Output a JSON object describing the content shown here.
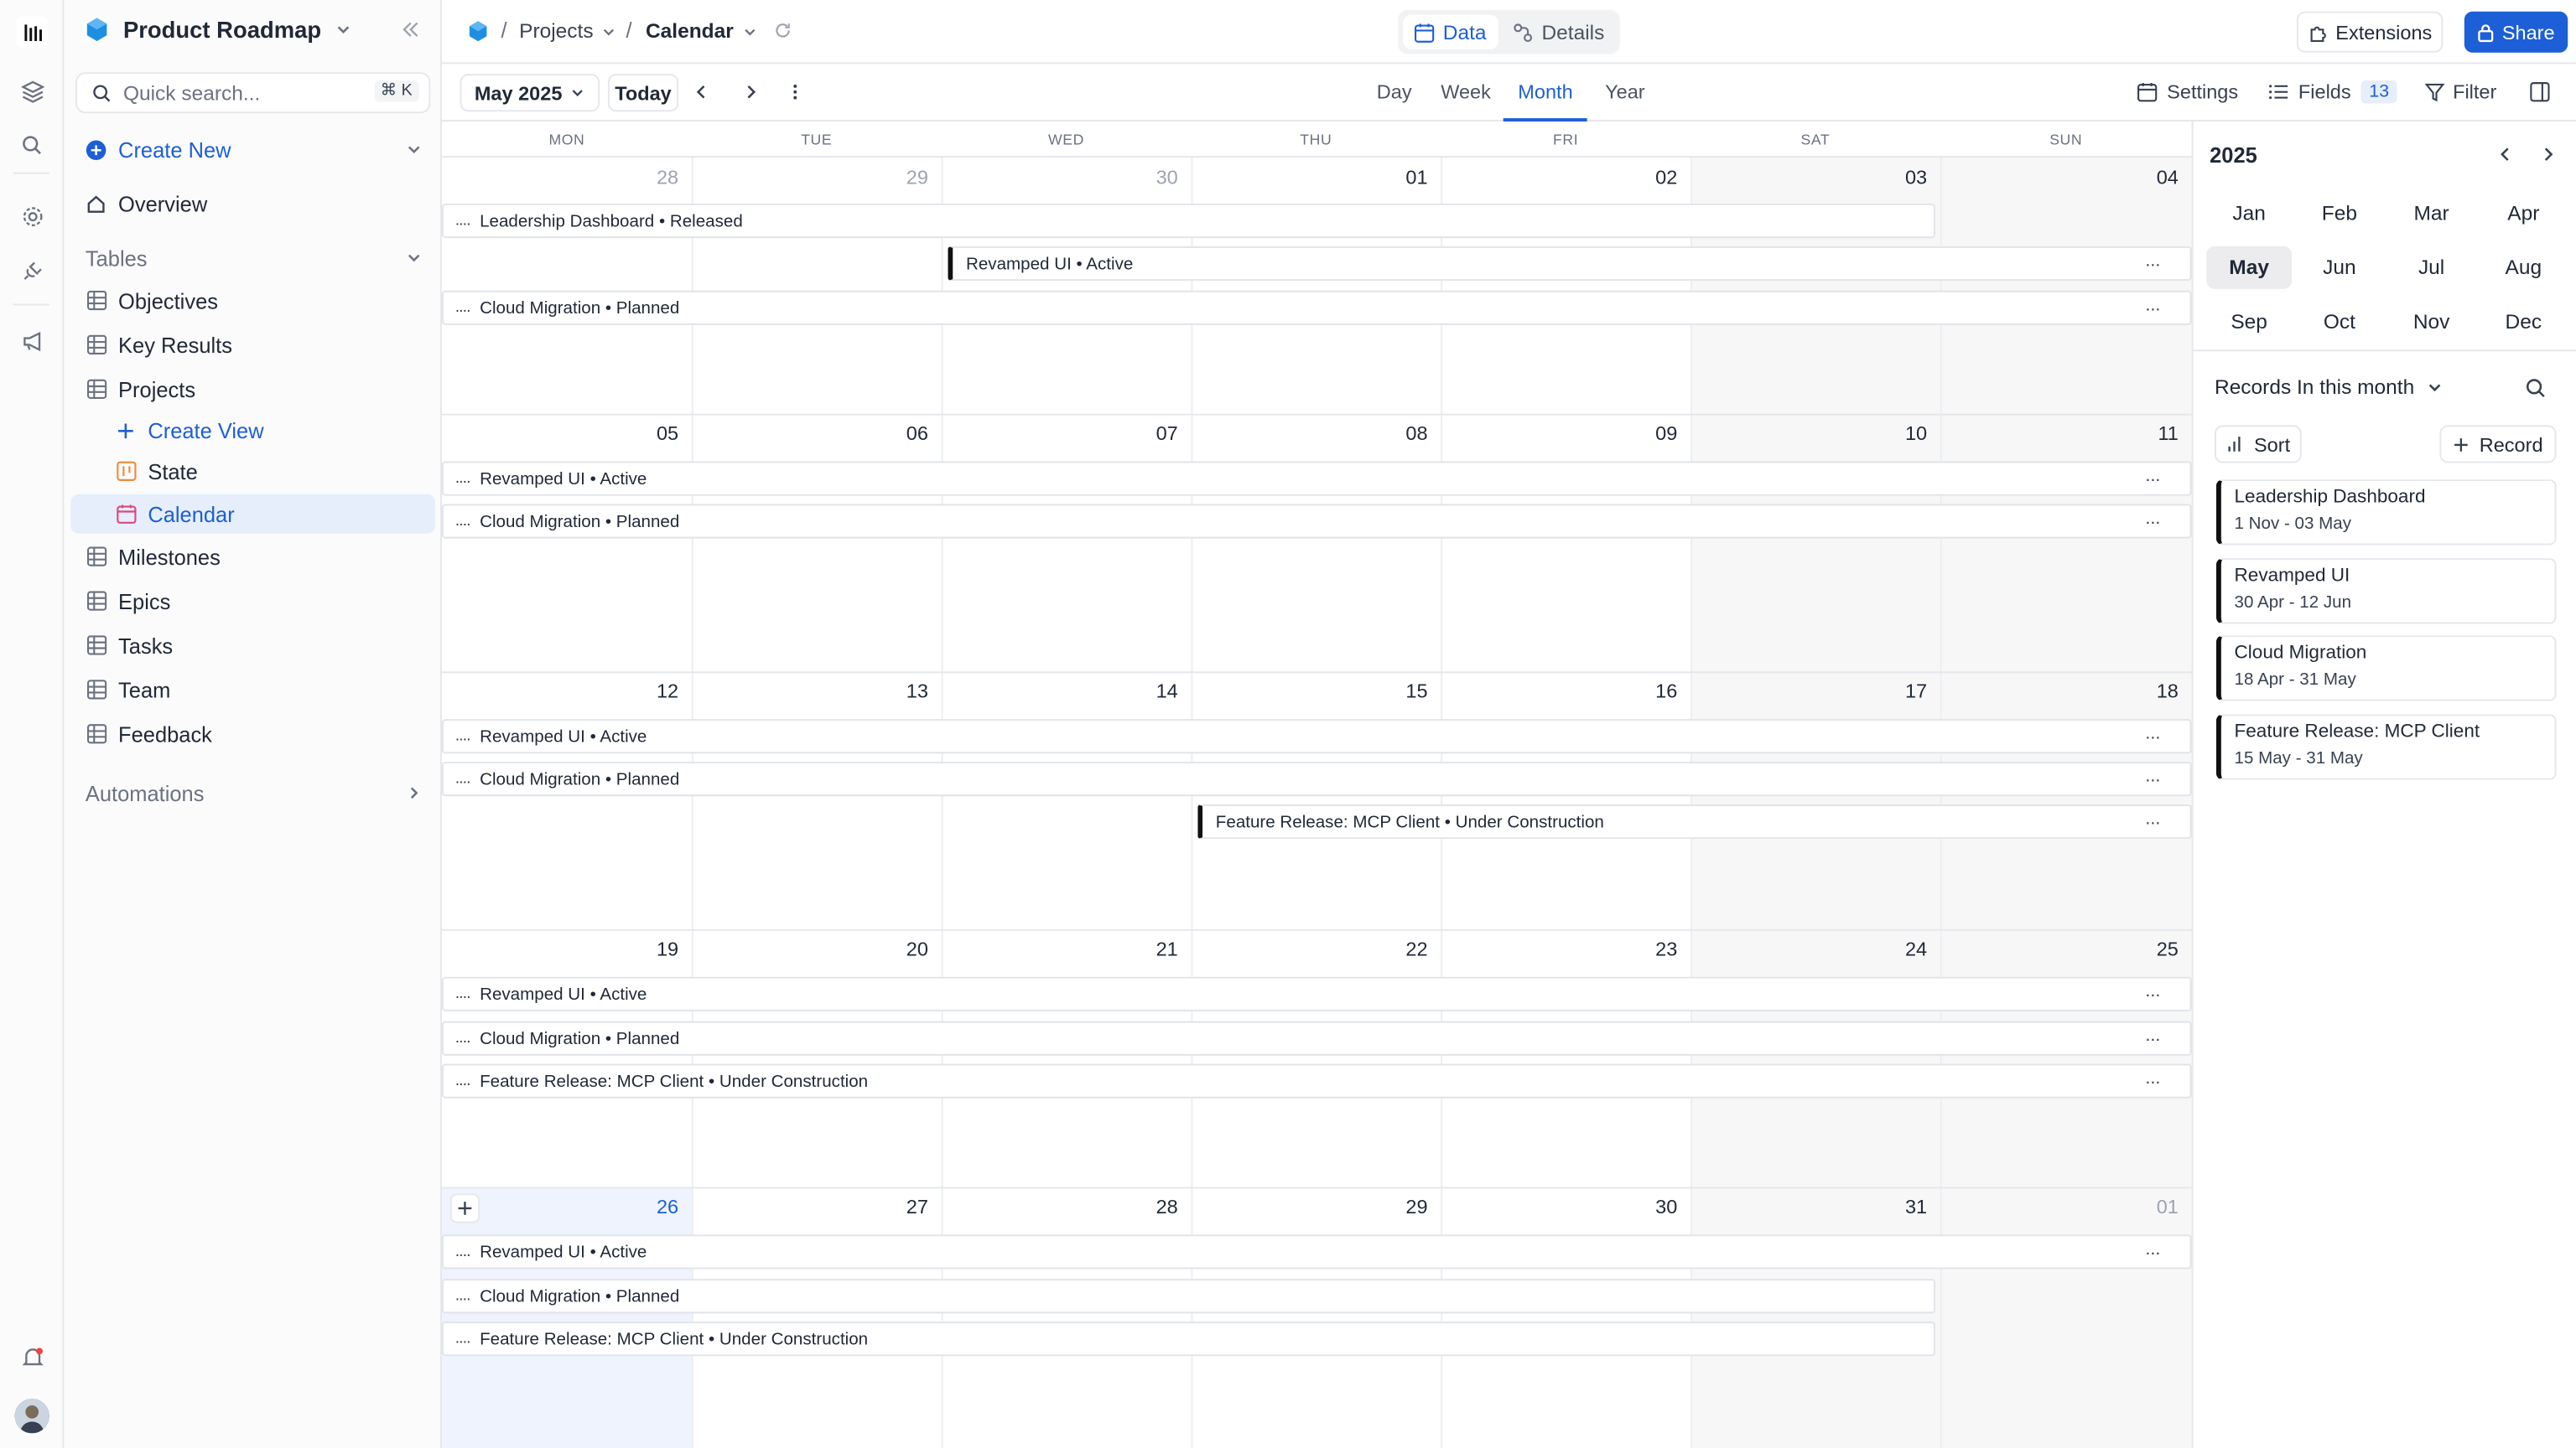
{
  "app": {
    "title": "Product Roadmap",
    "accent": "#1d5fd6"
  },
  "search": {
    "placeholder": "Quick search...",
    "shortcut": "⌘ K"
  },
  "sidebar": {
    "create_new": "Create New",
    "overview": "Overview",
    "tables_label": "Tables",
    "tables": [
      "Objectives",
      "Key Results",
      "Projects"
    ],
    "project_views": {
      "create_view": "Create View",
      "state": "State",
      "calendar": "Calendar"
    },
    "tables_after": [
      "Milestones",
      "Epics",
      "Tasks",
      "Team",
      "Feedback"
    ],
    "automations": "Automations"
  },
  "breadcrumb": {
    "projects": "Projects",
    "calendar": "Calendar"
  },
  "view_toggle": {
    "data": "Data",
    "details": "Details"
  },
  "actions": {
    "extensions": "Extensions",
    "share": "Share"
  },
  "toolbar": {
    "month_picker": "May 2025",
    "today": "Today",
    "modes": [
      "Day",
      "Week",
      "Month",
      "Year"
    ],
    "active_mode": "Month",
    "settings": "Settings",
    "fields": "Fields",
    "fields_count": "13",
    "filter": "Filter"
  },
  "calendar": {
    "days": [
      "MON",
      "TUE",
      "WED",
      "THU",
      "FRI",
      "SAT",
      "SUN"
    ],
    "weeks": [
      [
        "28",
        "29",
        "30",
        "01",
        "02",
        "03",
        "04"
      ],
      [
        "05",
        "06",
        "07",
        "08",
        "09",
        "10",
        "11"
      ],
      [
        "12",
        "13",
        "14",
        "15",
        "16",
        "17",
        "18"
      ],
      [
        "19",
        "20",
        "21",
        "22",
        "23",
        "24",
        "25"
      ],
      [
        "26",
        "27",
        "28",
        "29",
        "30",
        "31",
        "01"
      ]
    ],
    "events": {
      "leadership": "Leadership Dashboard • Released",
      "revamped": "Revamped UI • Active",
      "cloud": "Cloud Migration • Planned",
      "feature": "Feature Release: MCP Client • Under Construction"
    },
    "ellipsis": "....",
    "more": "..."
  },
  "right_panel": {
    "year": "2025",
    "months": [
      "Jan",
      "Feb",
      "Mar",
      "Apr",
      "May",
      "Jun",
      "Jul",
      "Aug",
      "Sep",
      "Oct",
      "Nov",
      "Dec"
    ],
    "selected_month": "May",
    "records_title": "Records In this month",
    "sort": "Sort",
    "record": "Record",
    "records": [
      {
        "name": "Leadership Dashboard",
        "range": "1 Nov - 03 May"
      },
      {
        "name": "Revamped UI",
        "range": "30 Apr - 12 Jun"
      },
      {
        "name": "Cloud Migration",
        "range": "18 Apr - 31 May"
      },
      {
        "name": "Feature Release: MCP Client",
        "range": "15 May - 31 May"
      }
    ]
  }
}
